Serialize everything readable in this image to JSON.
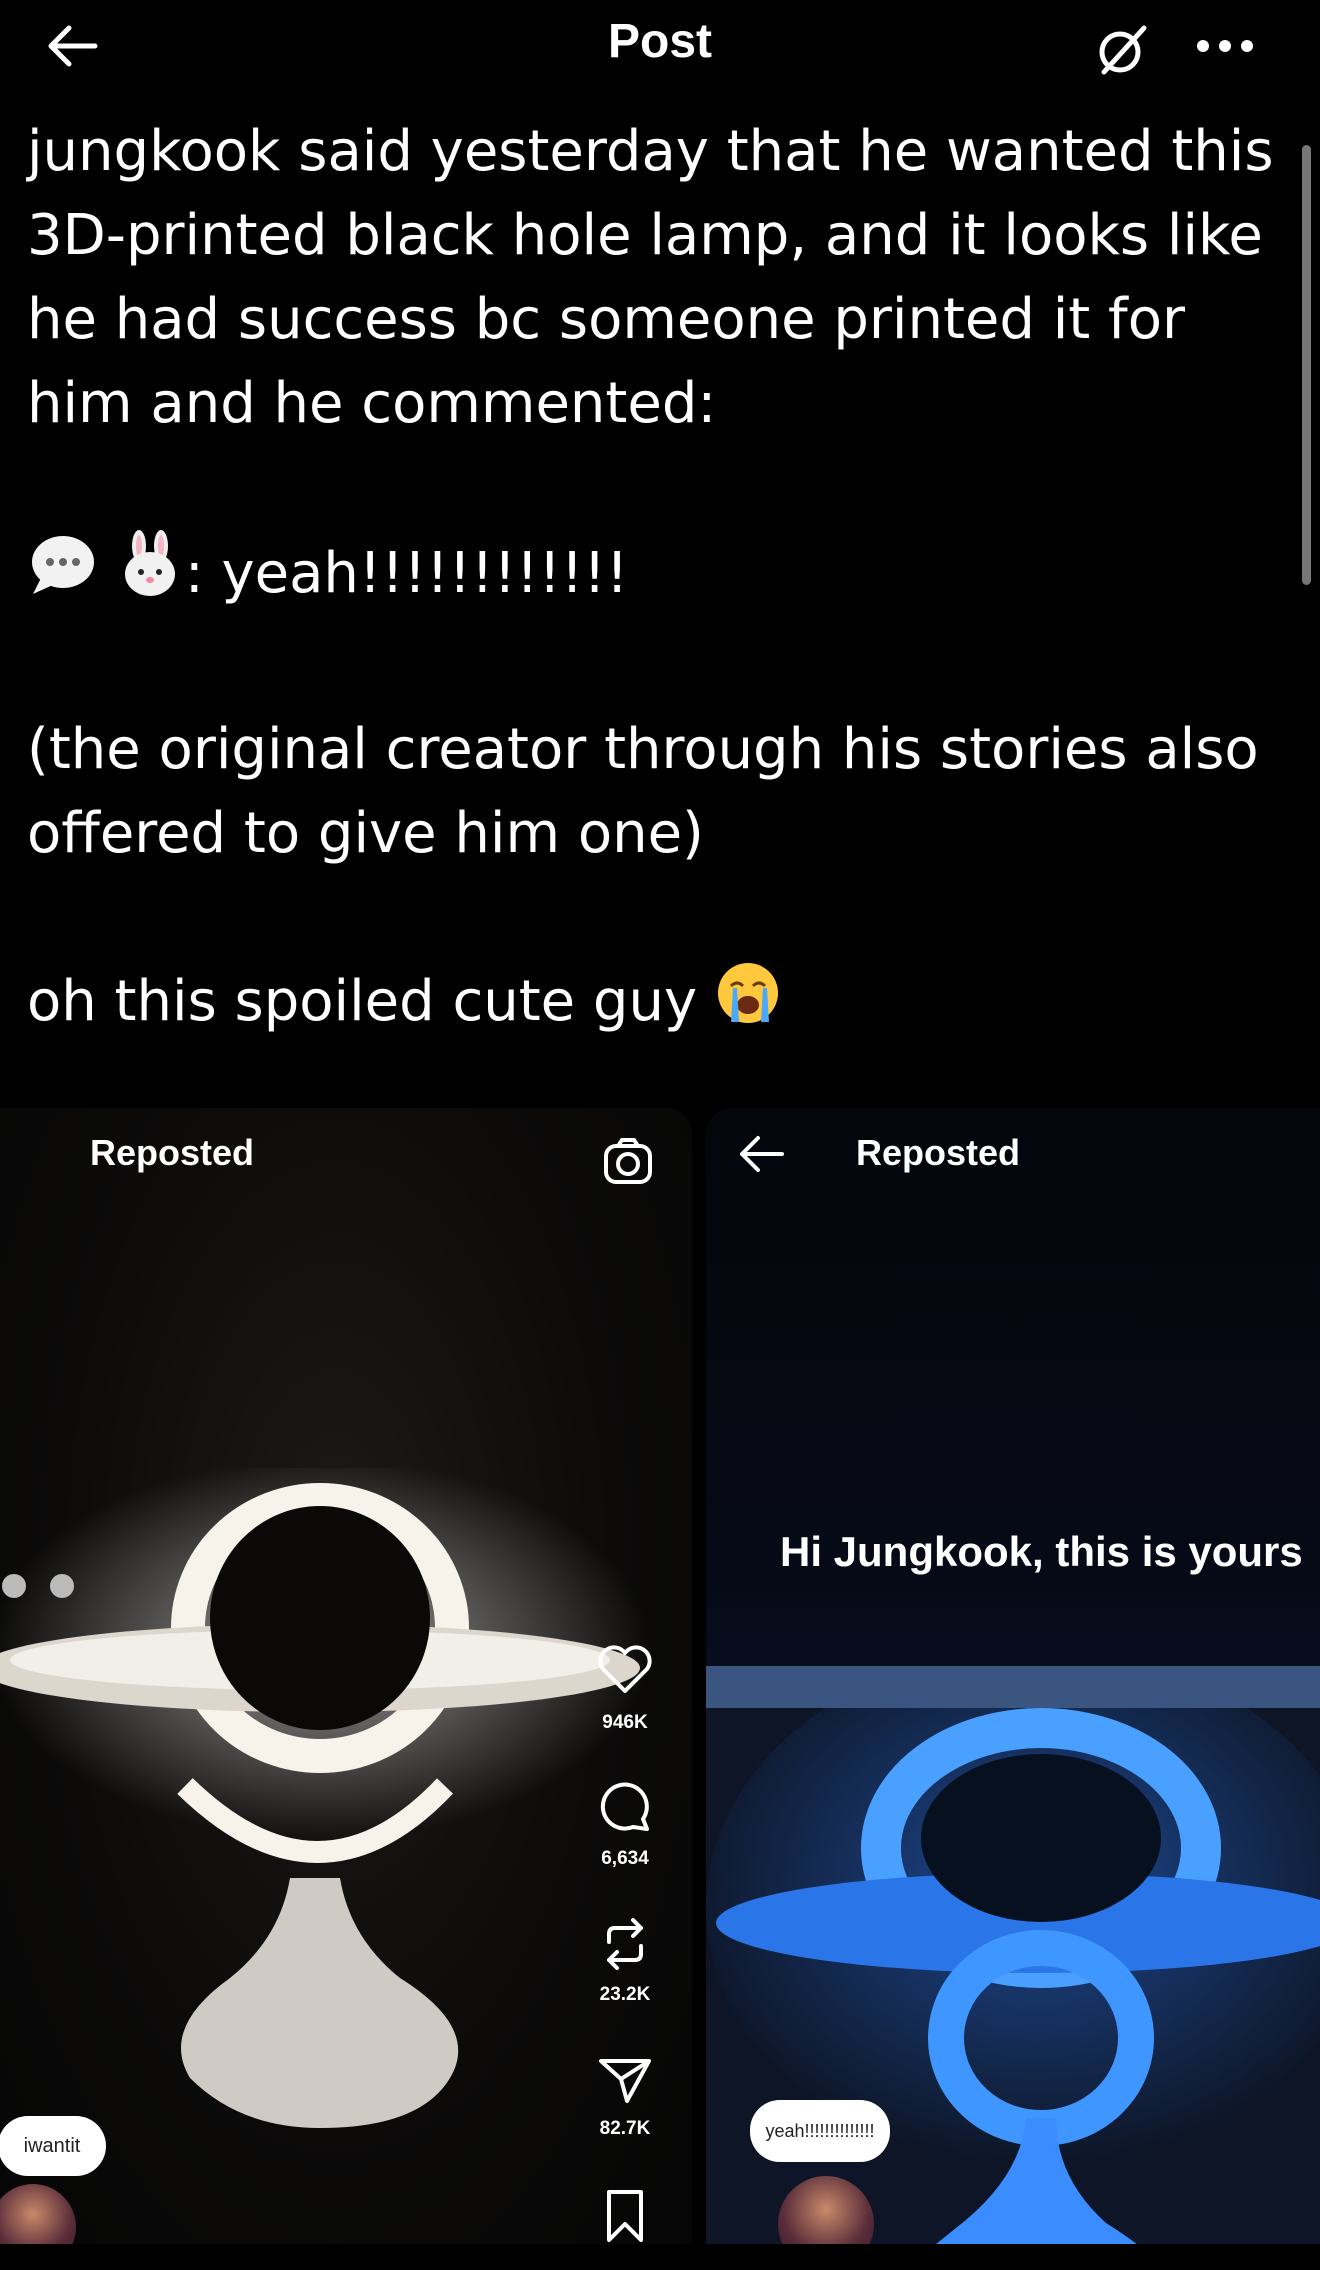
{
  "header": {
    "title": "Post",
    "back_icon": "arrow-left-icon",
    "grok_icon": "grok-icon",
    "more_icon": "more-horizontal-icon"
  },
  "post": {
    "paragraph1": "jungkook said yesterday that he wanted this 3D-printed black hole lamp, and it looks like he had success bc someone printed it for him and he commented:",
    "comment_prefix_icons": [
      "speech-bubble-emoji",
      "rabbit-face-emoji"
    ],
    "comment_text": ": yeah!!!!!!!!!!!!",
    "paragraph3": "(the original creator through his stories also offered to give him one)",
    "paragraph4": "oh this spoiled cute guy",
    "paragraph4_emoji": "loudly-crying-face-emoji"
  },
  "media": {
    "left": {
      "header_label": "Reposted",
      "comment_bubble": "iwantit",
      "stats": {
        "likes": "946K",
        "comments": "6,634",
        "reposts": "23.2K",
        "shares": "82.7K"
      }
    },
    "right": {
      "header_label": "Reposted",
      "overlay_text": "Hi Jungkook, this is yours",
      "comment_bubble": "yeah!!!!!!!!!!!!!!"
    }
  },
  "colors": {
    "background": "#000000",
    "text": "#ffffff",
    "lamp_blue": "#3a8cff",
    "lamp_white": "#f2efe8"
  }
}
